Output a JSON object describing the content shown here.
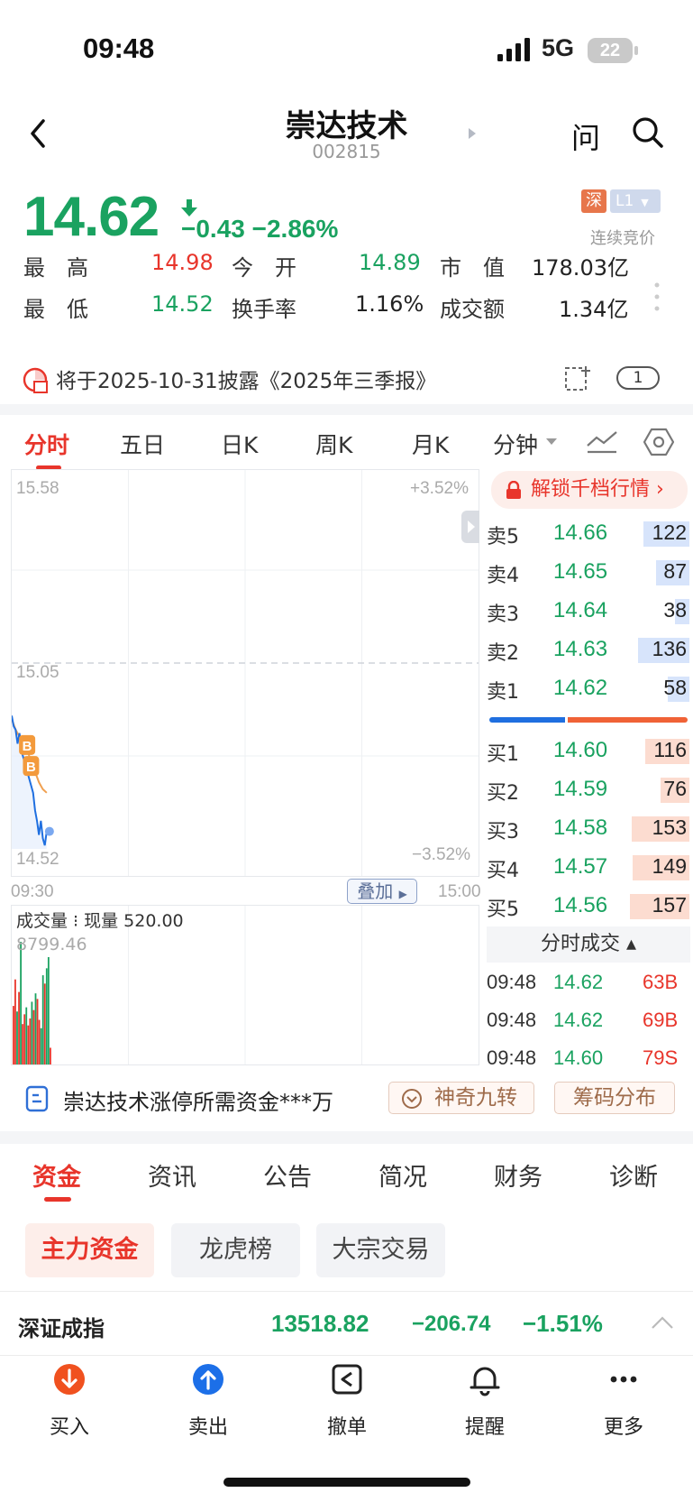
{
  "status_bar": {
    "time": "09:48",
    "network": "5G",
    "battery": "22"
  },
  "header": {
    "stock_name": "崇达技术",
    "stock_code": "002815",
    "ask": "问"
  },
  "quote": {
    "price": "14.62",
    "change": "−0.43 −2.86%",
    "exchange_badge": "深",
    "level_badge": "L1",
    "auction_status": "连续竞价",
    "stats": {
      "high_label": "最　高",
      "high": "14.98",
      "open_label": "今　开",
      "open": "14.89",
      "mcap_label": "市　值",
      "mcap": "178.03亿",
      "low_label": "最　低",
      "low": "14.52",
      "turnover_label": "换手率",
      "turnover": "1.16%",
      "amount_label": "成交额",
      "amount": "1.34亿"
    }
  },
  "notice": {
    "text": "将于2025-10-31披露《2025年三季报》",
    "count": "1"
  },
  "chart_tabs": [
    "分时",
    "五日",
    "日K",
    "周K",
    "月K",
    "分钟"
  ],
  "chart_data": {
    "type": "line",
    "title": "",
    "x_start_label": "09:30",
    "x_end_label": "15:00",
    "y_high_label": "15.58",
    "y_mid_label": "15.05",
    "y_low_label": "14.52",
    "pct_high_label": "+3.52%",
    "pct_low_label": "−3.52%",
    "ylim": [
      14.52,
      15.58
    ],
    "prev_close": 15.05,
    "total_minutes": 240,
    "series": [
      {
        "type": "price",
        "x": [
          0,
          1,
          2,
          3,
          4,
          5,
          6,
          7,
          8,
          9,
          10,
          11,
          12,
          13,
          14,
          15,
          16,
          17,
          18
        ],
        "values": [
          14.9,
          14.87,
          14.86,
          14.82,
          14.85,
          14.8,
          14.78,
          14.76,
          14.74,
          14.72,
          14.7,
          14.68,
          14.63,
          14.6,
          14.56,
          14.6,
          14.55,
          14.53,
          14.57
        ]
      },
      {
        "type": "average",
        "x": [
          0,
          2,
          4,
          6,
          8,
          10,
          12,
          14,
          16,
          18
        ],
        "values": [
          14.89,
          14.86,
          14.84,
          14.82,
          14.8,
          14.77,
          14.74,
          14.71,
          14.69,
          14.68
        ]
      }
    ],
    "markers": [
      {
        "label": "B",
        "x": 7,
        "price": 14.77
      },
      {
        "label": "B",
        "x": 9,
        "price": 14.71
      }
    ],
    "volume": {
      "label": "成交量 ⁝ 现量 520.00",
      "max_label": "8799.46",
      "max": 8799.46,
      "values": [
        4200,
        6100,
        3800,
        5200,
        8799,
        2900,
        3600,
        4100,
        2800,
        3300,
        4500,
        3900,
        5100,
        4700,
        3200,
        2600,
        6400,
        5800,
        6900,
        7700,
        1200
      ],
      "up": [
        false,
        false,
        true,
        false,
        true,
        false,
        false,
        true,
        false,
        false,
        true,
        false,
        true,
        false,
        false,
        true,
        true,
        false,
        true,
        true,
        false
      ]
    },
    "stack_button": "叠加"
  },
  "order_book": {
    "unlock_label": "解锁千档行情 ›",
    "asks": [
      {
        "label": "卖5",
        "price": "14.66",
        "vol": "122",
        "size": 122
      },
      {
        "label": "卖4",
        "price": "14.65",
        "vol": "87",
        "size": 87
      },
      {
        "label": "卖3",
        "price": "14.64",
        "vol": "38",
        "size": 38
      },
      {
        "label": "卖2",
        "price": "14.63",
        "vol": "136",
        "size": 136
      },
      {
        "label": "卖1",
        "price": "14.62",
        "vol": "58",
        "size": 58
      }
    ],
    "bids": [
      {
        "label": "买1",
        "price": "14.60",
        "vol": "116",
        "size": 116
      },
      {
        "label": "买2",
        "price": "14.59",
        "vol": "76",
        "size": 76
      },
      {
        "label": "买3",
        "price": "14.58",
        "vol": "153",
        "size": 153
      },
      {
        "label": "买4",
        "price": "14.57",
        "vol": "149",
        "size": 149
      },
      {
        "label": "买5",
        "price": "14.56",
        "vol": "157",
        "size": 157
      }
    ],
    "bid_ratio": 0.38,
    "trades_header": "分时成交 ▴",
    "trades": [
      {
        "time": "09:48",
        "price": "14.62",
        "vol": "63B"
      },
      {
        "time": "09:48",
        "price": "14.62",
        "vol": "69B"
      },
      {
        "time": "09:48",
        "price": "14.60",
        "vol": "79S"
      }
    ]
  },
  "features": {
    "limit_up": "崇达技术涨停所需资金***万",
    "nine_turns": "神奇九转",
    "chip_dist": "筹码分布"
  },
  "section_tabs": [
    "资金",
    "资讯",
    "公告",
    "简况",
    "财务",
    "诊断"
  ],
  "sub_tabs": [
    "主力资金",
    "龙虎榜",
    "大宗交易"
  ],
  "index_bar": {
    "name": "深证成指",
    "value": "13518.82",
    "change": "−206.74",
    "pct": "−1.51%"
  },
  "bottom_nav": [
    {
      "label": "买入",
      "icon": "buy-icon"
    },
    {
      "label": "卖出",
      "icon": "sell-icon"
    },
    {
      "label": "撤单",
      "icon": "cancel-order-icon"
    },
    {
      "label": "提醒",
      "icon": "bell-icon"
    },
    {
      "label": "更多",
      "icon": "more-icon"
    }
  ],
  "colors": {
    "up": "#e8352b",
    "down": "#1aa260",
    "price_line": "#1f6fe0",
    "avg_line": "#f0a050"
  }
}
